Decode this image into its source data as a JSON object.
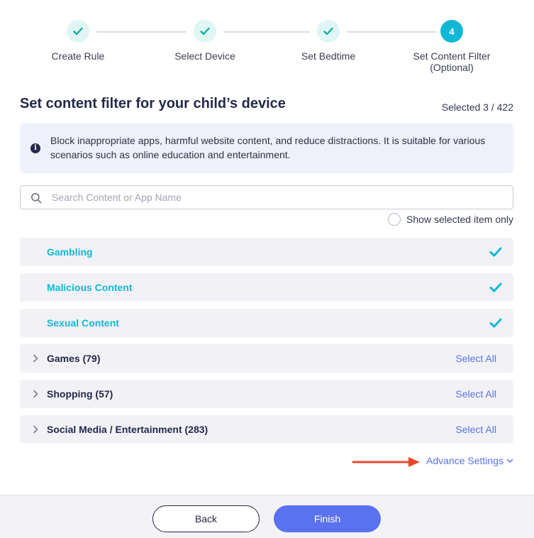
{
  "stepper": {
    "steps": [
      {
        "label": "Create Rule",
        "status": "done"
      },
      {
        "label": "Select Device",
        "status": "done"
      },
      {
        "label": "Set Bedtime",
        "status": "done"
      },
      {
        "label": "Set Content Filter",
        "label2": "(Optional)",
        "status": "active",
        "number": "4"
      }
    ]
  },
  "header": {
    "title": "Set content filter for your child’s device",
    "selected_count": "Selected 3 / 422"
  },
  "info": {
    "icon": "info-icon",
    "text": "Block inappropriate apps, harmful website content, and reduce distractions. It is suitable for various scenarios such as online education and entertainment."
  },
  "search": {
    "placeholder": "Search Content or App Name",
    "value": ""
  },
  "filter": {
    "show_selected_label": "Show selected item only",
    "show_selected_checked": false
  },
  "categories": [
    {
      "label": "Gambling",
      "selected": true
    },
    {
      "label": "Malicious Content",
      "selected": true
    },
    {
      "label": "Sexual Content",
      "selected": true
    },
    {
      "label": "Games (79)",
      "selected": false,
      "action": "Select All"
    },
    {
      "label": "Shopping (57)",
      "selected": false,
      "action": "Select All"
    },
    {
      "label": "Social Media / Entertainment (283)",
      "selected": false,
      "action": "Select All"
    }
  ],
  "advance": {
    "label": "Advance Settings"
  },
  "footer": {
    "back_label": "Back",
    "finish_label": "Finish"
  },
  "colors": {
    "accent": "#13b7d6",
    "primary": "#5a72f0",
    "link": "#5a72e8",
    "annotation_arrow": "#e8472c"
  }
}
